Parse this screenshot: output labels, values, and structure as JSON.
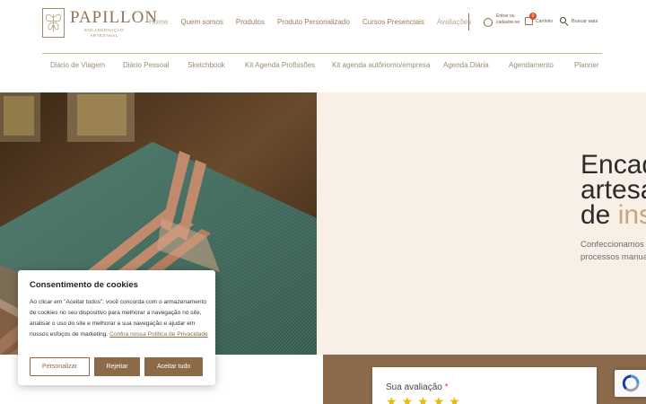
{
  "brand": {
    "name": "PAPILLON",
    "tagline": "ENCADERNAÇÃO ARTESANAL"
  },
  "nav": {
    "items": [
      "Home",
      "Quem somos",
      "Produtos",
      "Produto Personalizado",
      "Cursos Presenciais",
      "Avaliações"
    ]
  },
  "account": {
    "label": "Entrar ou cadastre-se"
  },
  "cart": {
    "count": "0",
    "label": "Carrinho"
  },
  "search": {
    "placeholder": "Buscar aqui"
  },
  "categories": [
    "Diário de Viagem",
    "Diário Pessoal",
    "Sketchbook",
    "Kit Agenda Profissões",
    "Kit agenda autônomo/empresa",
    "Agenda Diária",
    "Agendamento",
    "Planner"
  ],
  "hero": {
    "title_line1": "Encad",
    "title_line2": "artesa",
    "title_line3_prefix": "de ",
    "title_line3_accent": "ins",
    "desc_line1": "Confeccionamos c",
    "desc_line2": "processos manua"
  },
  "review": {
    "label": "Sua avaliação",
    "required_mark": "*",
    "stars": 5
  },
  "cookie": {
    "title": "Consentimento de cookies",
    "body": " Ao clicar em \"Aceitar todos\", você concorda com o armazenamento de cookies no seu dispositivo para melhorar a navegação no site, analisar o uso do site e melhorar a sua navegação e ajudar em nossos esfoços de marketing. ",
    "link": "Confira nossa Política de Privacidade",
    "btn_customize": "Personalizar",
    "btn_reject": "Rejeitar",
    "btn_accept": "Aceitar tudo"
  },
  "colors": {
    "brand_brown": "#8c6a48",
    "hero_bg": "#f8efe6",
    "accent_gold": "#c7a47c",
    "star": "#e7b80e",
    "badge_red": "#e04b2b"
  }
}
